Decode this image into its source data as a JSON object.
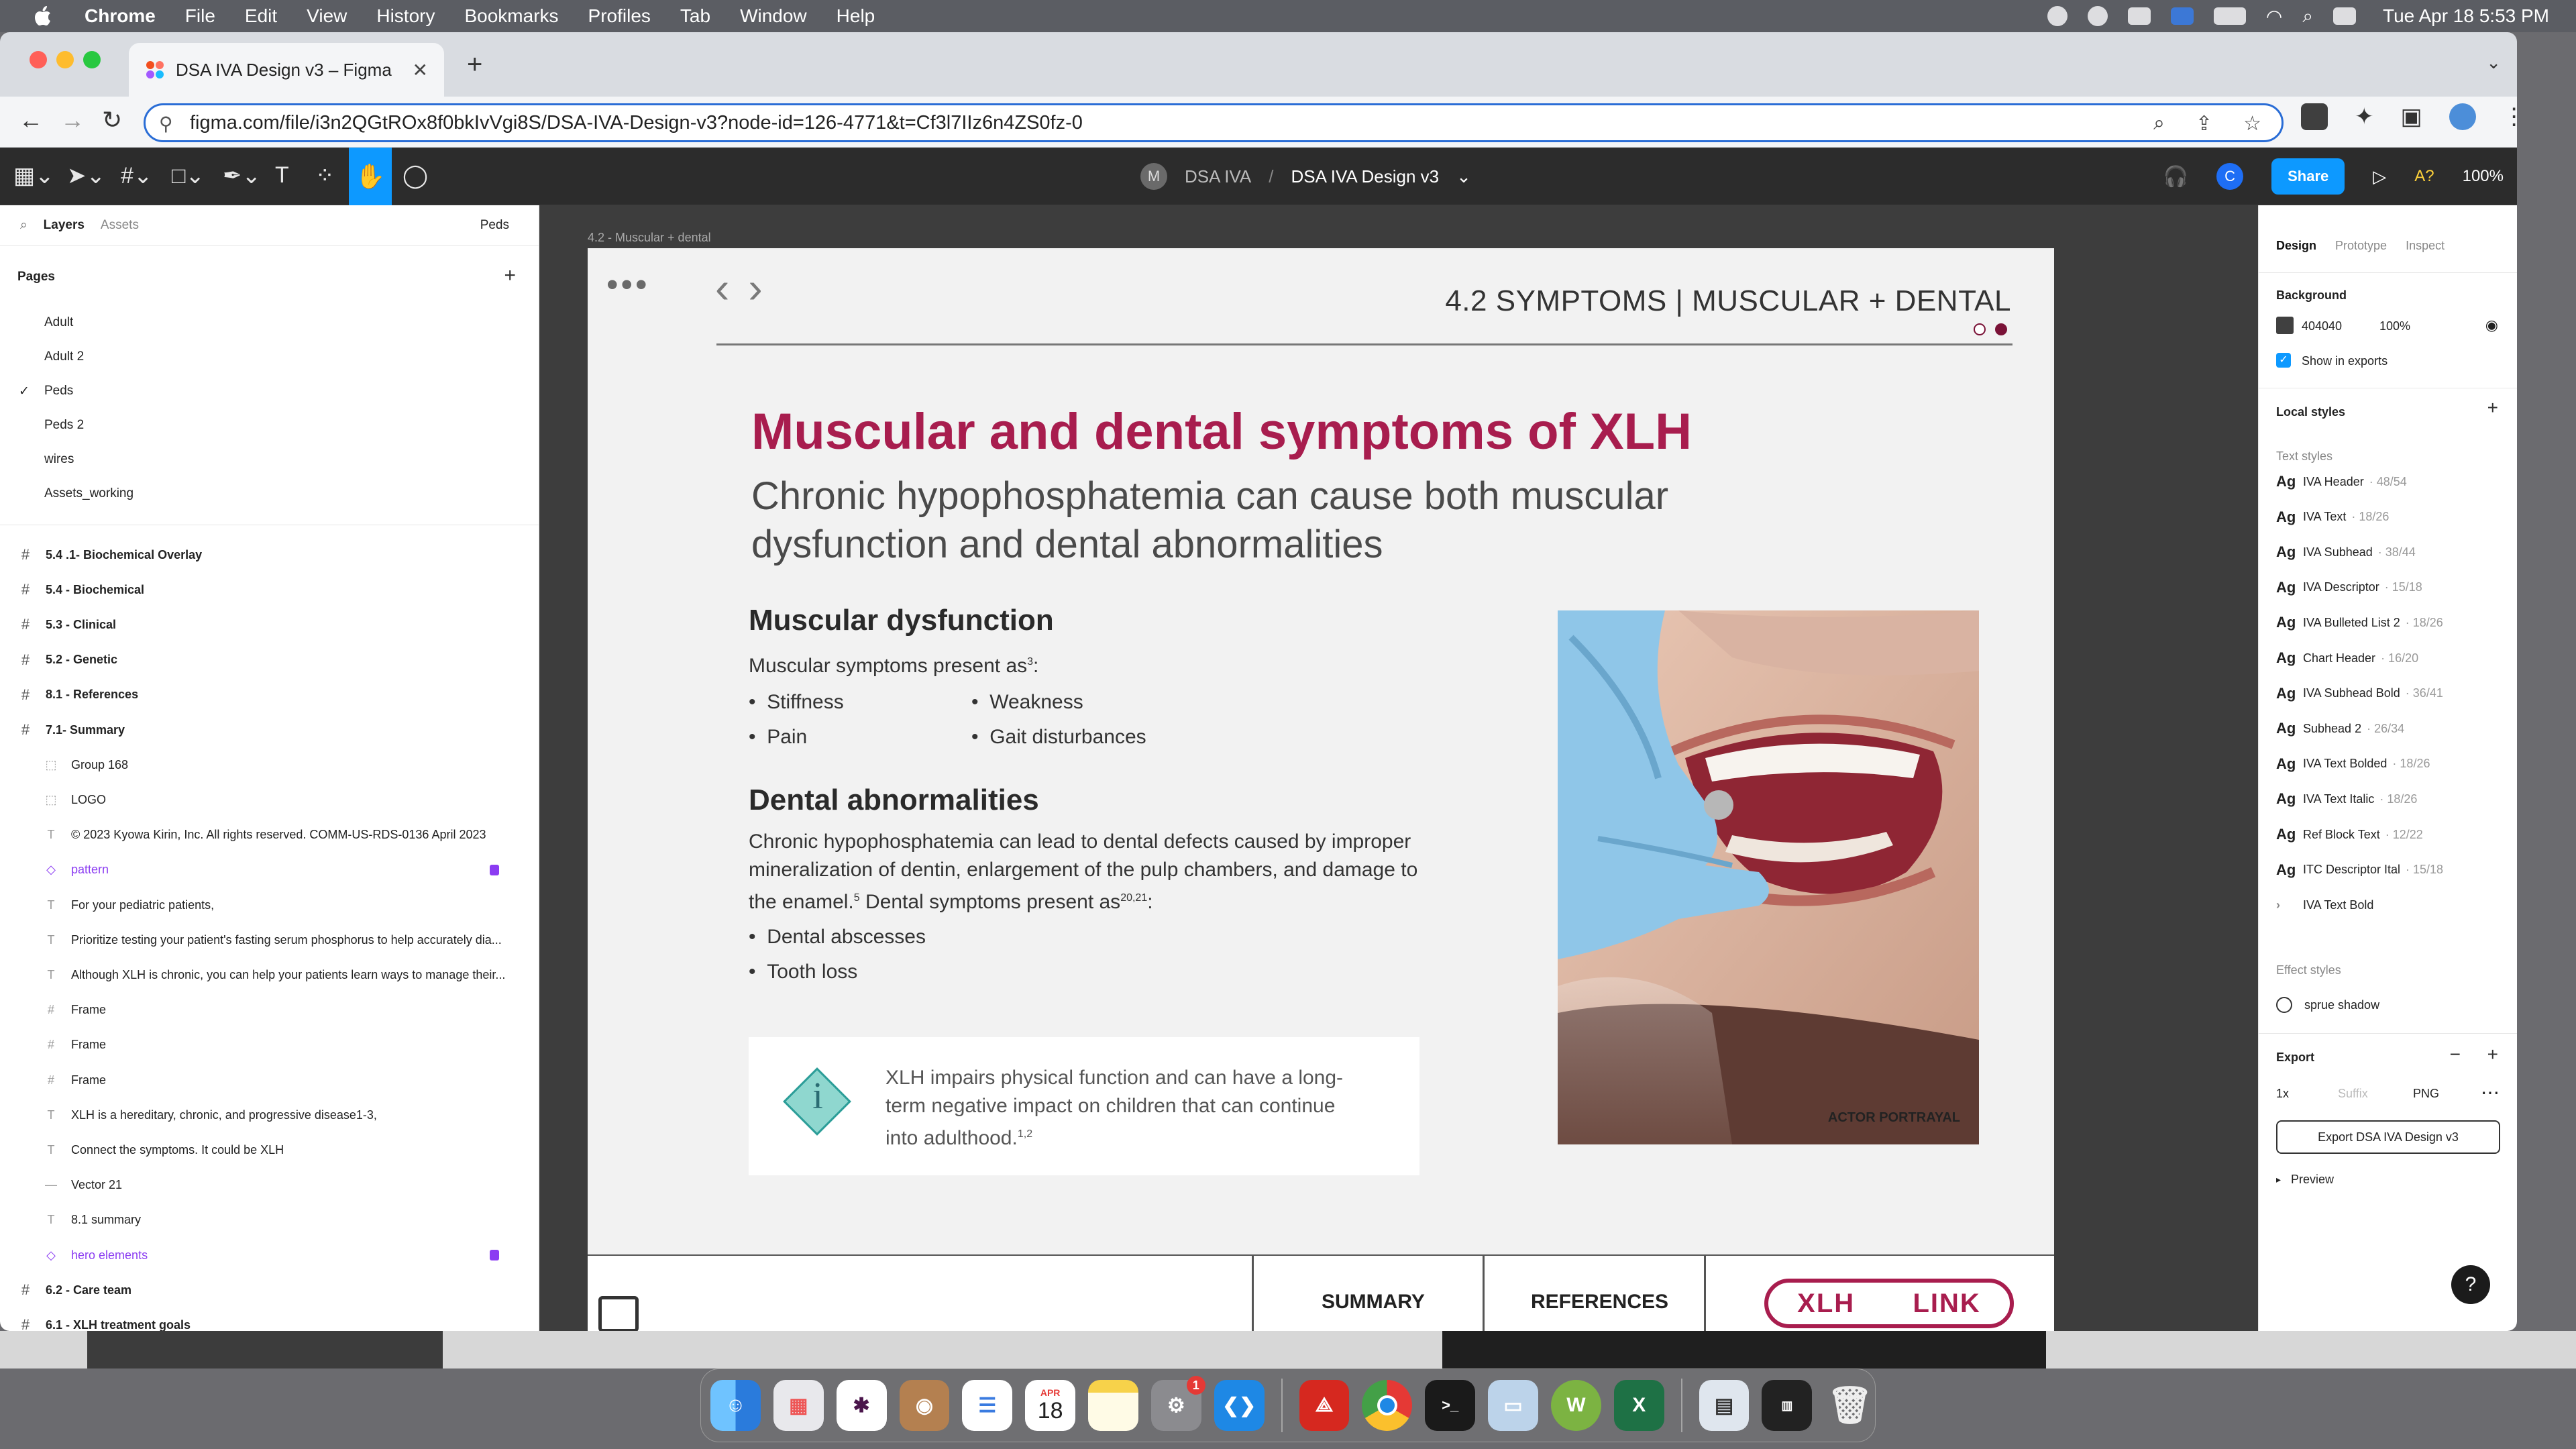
{
  "menubar": {
    "app": "Chrome",
    "items": [
      "File",
      "Edit",
      "View",
      "History",
      "Bookmarks",
      "Profiles",
      "Tab",
      "Window",
      "Help"
    ],
    "datetime": "Tue Apr 18  5:53 PM"
  },
  "browser": {
    "tab_title": "DSA IVA Design v3 – Figma",
    "url": "figma.com/file/i3n2QGtROx8f0bkIvVgi8S/DSA-IVA-Design-v3?node-id=126-4771&t=Cf3l7IIz6n4ZS0fz-0"
  },
  "figma": {
    "team": "DSA IVA",
    "separator": "/",
    "file": "DSA IVA Design v3",
    "avatar_m": "M",
    "avatar_c": "C",
    "share": "Share",
    "zoom": "100%",
    "a_label": "A?"
  },
  "left": {
    "tabs": [
      "Layers",
      "Assets"
    ],
    "page_select": "Peds",
    "pages_heading": "Pages",
    "pages": [
      "Adult",
      "Adult 2",
      "Peds",
      "Peds 2",
      "wires",
      "Assets_working"
    ],
    "layers": [
      {
        "type": "frame",
        "icon": "#",
        "name": "5.4 .1- Biochemical Overlay"
      },
      {
        "type": "frame",
        "icon": "#",
        "name": "5.4 - Biochemical"
      },
      {
        "type": "frame",
        "icon": "#",
        "name": "5.3 - Clinical"
      },
      {
        "type": "frame",
        "icon": "#",
        "name": "5.2 - Genetic"
      },
      {
        "type": "frame",
        "icon": "#",
        "name": "8.1 - References"
      },
      {
        "type": "frame",
        "icon": "#",
        "name": "7.1- Summary"
      },
      {
        "type": "child",
        "icon": "⬚",
        "name": "Group 168"
      },
      {
        "type": "child",
        "icon": "⬚",
        "name": "LOGO"
      },
      {
        "type": "child",
        "icon": "T",
        "name": "© 2023 Kyowa Kirin, Inc. All rights reserved. COMM-US-RDS-0136 April 2023"
      },
      {
        "type": "child",
        "icon": "◇",
        "name": "pattern",
        "component": true,
        "locked": true
      },
      {
        "type": "child",
        "icon": "T",
        "name": "For your pediatric patients,"
      },
      {
        "type": "child",
        "icon": "T",
        "name": "Prioritize testing your patient's fasting serum phosphorus to help accurately dia..."
      },
      {
        "type": "child",
        "icon": "T",
        "name": "Although XLH is chronic, you can help your patients learn ways to manage their..."
      },
      {
        "type": "child",
        "icon": "#",
        "name": "Frame"
      },
      {
        "type": "child",
        "icon": "#",
        "name": "Frame"
      },
      {
        "type": "child",
        "icon": "#",
        "name": "Frame"
      },
      {
        "type": "child",
        "icon": "T",
        "name": "XLH is a hereditary, chronic, and progressive disease1-3,"
      },
      {
        "type": "child",
        "icon": "T",
        "name": "Connect the symptoms. It could be XLH"
      },
      {
        "type": "child",
        "icon": "—",
        "name": "Vector 21"
      },
      {
        "type": "child",
        "icon": "T",
        "name": "8.1 summary"
      },
      {
        "type": "child",
        "icon": "◇",
        "name": "hero elements",
        "component": true,
        "locked": true
      },
      {
        "type": "frame",
        "icon": "#",
        "name": "6.2 - Care team"
      },
      {
        "type": "frame",
        "icon": "#",
        "name": "6.1 - XLH treatment goals"
      },
      {
        "type": "frame",
        "icon": "#",
        "name": "6.1 - XLH treatment goals"
      }
    ]
  },
  "canvas": {
    "frame_label": "4.2 - Muscular + dental"
  },
  "slide": {
    "section": "4.2 SYMPTOMS | MUSCULAR + DENTAL",
    "title": "Muscular and dental symptoms of XLH",
    "subtitle": "Chronic hypophosphatemia can cause both muscular dysfunction and dental abnormalities",
    "muscular_heading": "Muscular dysfunction",
    "muscular_intro": "Muscular symptoms present as",
    "muscular_ref": "3",
    "colon": ":",
    "muscular_list": [
      "Stiffness",
      "Pain",
      "Weakness",
      "Gait disturbances"
    ],
    "dental_heading": "Dental abnormalities",
    "dental_text_1": "Chronic hypophosphatemia can lead to dental defects caused by improper mineralization of dentin, enlargement of the pulp chambers, and damage to the enamel.",
    "dental_ref_1": "5",
    "dental_text_2": " Dental symptoms present as",
    "dental_ref_2": "20,21",
    "dental_list": [
      "Dental abscesses",
      "Tooth loss"
    ],
    "callout_text": "XLH impairs physical function and can have a long-term negative impact on children that can continue into adulthood.",
    "callout_ref": "1,2",
    "callout_icon": "i",
    "photo_caption": "ACTOR PORTRAYAL",
    "footer_summary": "SUMMARY",
    "footer_references": "REFERENCES",
    "logo_left": "XLH",
    "logo_right": "LINK",
    "pagination_total": 2,
    "pagination_current": 2
  },
  "right": {
    "tabs": [
      "Design",
      "Prototype",
      "Inspect"
    ],
    "background_heading": "Background",
    "bg_hex": "404040",
    "bg_opacity": "100%",
    "show_exports": "Show in exports",
    "local_styles": "Local styles",
    "text_styles_heading": "Text styles",
    "text_styles": [
      {
        "name": "IVA Header",
        "meta": "· 48/54"
      },
      {
        "name": "IVA Text",
        "meta": "· 18/26"
      },
      {
        "name": "IVA Subhead",
        "meta": "· 38/44"
      },
      {
        "name": "IVA Descriptor",
        "meta": "· 15/18"
      },
      {
        "name": "IVA Bulleted List 2",
        "meta": "· 18/26"
      },
      {
        "name": "Chart Header",
        "meta": "· 16/20"
      },
      {
        "name": "IVA Subhead Bold",
        "meta": "· 36/41"
      },
      {
        "name": "Subhead 2",
        "meta": "· 26/34"
      },
      {
        "name": "IVA Text Bolded",
        "meta": "· 18/26"
      },
      {
        "name": "IVA Text Italic",
        "meta": "· 18/26"
      },
      {
        "name": "Ref Block Text",
        "meta": "· 12/22"
      },
      {
        "name": "ITC Descriptor Ital",
        "meta": "· 15/18"
      },
      {
        "name": "IVA Text Bold",
        "meta": ""
      }
    ],
    "effect_styles_heading": "Effect styles",
    "effect_style": "sprue shadow",
    "export_heading": "Export",
    "export_scale": "1x",
    "export_suffix": "Suffix",
    "export_format": "PNG",
    "export_button": "Export DSA IVA Design v3",
    "preview": "Preview"
  },
  "colors": {
    "accent": "#a81d4e",
    "figma_blue": "#0d99ff",
    "canvas_bg": "#404040"
  },
  "dock": {
    "calendar_month": "APR",
    "calendar_day": "18",
    "settings_badge": "1",
    "apps": [
      "finder-icon",
      "launchpad-icon",
      "slack-icon",
      "contacts-icon",
      "reminders-icon",
      "calendar-icon",
      "notes-icon",
      "settings-icon",
      "vscode-icon",
      "acrobat-icon",
      "chrome-icon",
      "terminal-icon",
      "preview-icon",
      "word-icon",
      "excel-icon",
      "screenshot-icon",
      "terminal2-icon",
      "trash-icon"
    ]
  }
}
